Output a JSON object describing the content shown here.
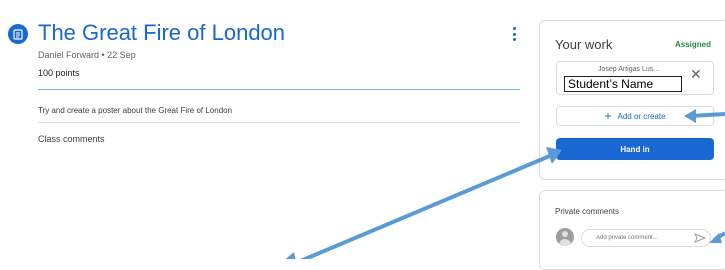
{
  "assignment": {
    "icon": "assignment-icon",
    "title": "The Great Fire of London",
    "meta": "Daniel Forward • 22 Sep",
    "points": "100 points",
    "instructions": "Try and create a poster about the Great Fire of London",
    "class_comments": "Class comments",
    "menu_icon": "more-vert-icon"
  },
  "your_work": {
    "title": "Your work",
    "status": "Assigned",
    "status_color": "#1e8e3e",
    "attachment_name": "Josep Artigas Lus...",
    "attachment_close_icon": "close-icon",
    "add_or_create": "Add or create",
    "add_icon": "plus-icon",
    "hand_in": "Hand in",
    "accent": "#1967d2"
  },
  "overlay": {
    "label": "Student’s Name"
  },
  "private_comments": {
    "title": "Private comments",
    "placeholder": "Add private comment...",
    "avatar_icon": "avatar-icon",
    "send_icon": "send-icon"
  },
  "annotation_color": "#5b9bd5"
}
